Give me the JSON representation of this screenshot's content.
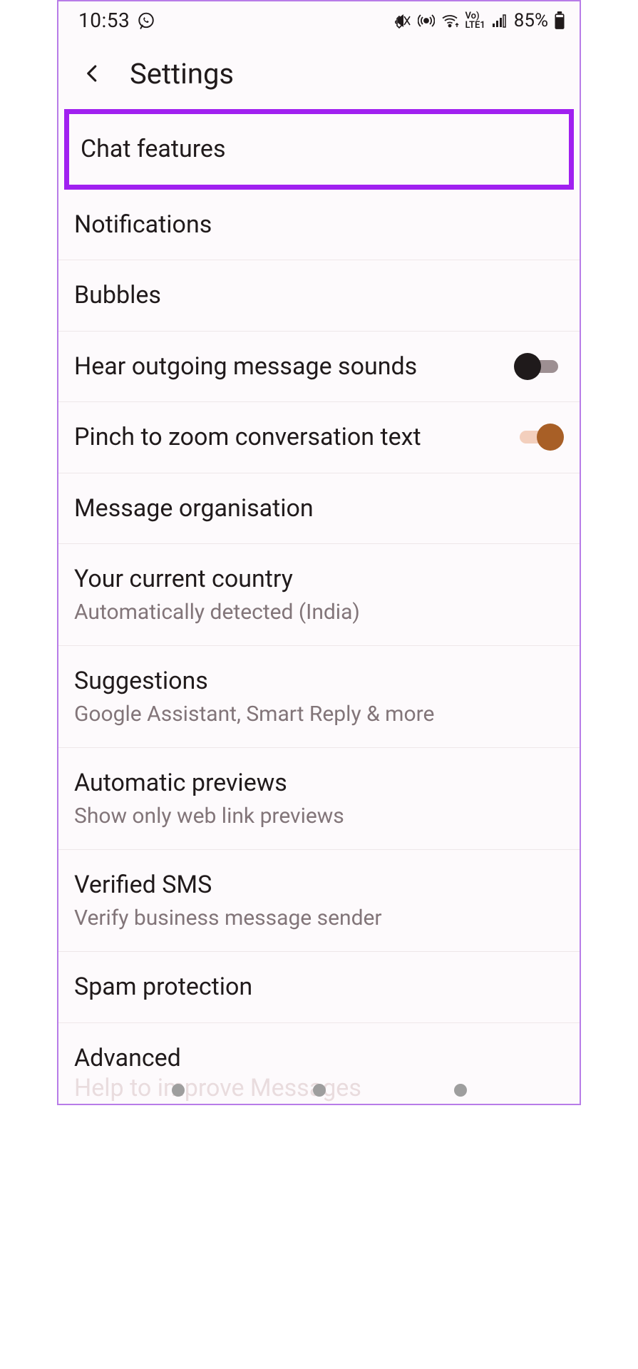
{
  "status": {
    "time": "10:53",
    "battery_pct": "85%",
    "lte_label": "Vo)\nLTE1"
  },
  "header": {
    "title": "Settings"
  },
  "rows": {
    "chat_features": "Chat features",
    "notifications": "Notifications",
    "bubbles": "Bubbles",
    "hear_sounds": "Hear outgoing message sounds",
    "pinch_zoom": "Pinch to zoom conversation text",
    "message_org": "Message organisation",
    "country_title": "Your current country",
    "country_sub": "Automatically detected (India)",
    "suggestions_title": "Suggestions",
    "suggestions_sub": "Google Assistant, Smart Reply & more",
    "previews_title": "Automatic previews",
    "previews_sub": "Show only web link previews",
    "verified_title": "Verified SMS",
    "verified_sub": "Verify business message sender",
    "spam": "Spam protection",
    "advanced": "Advanced",
    "help_improve": "Help to improve Messages"
  },
  "toggles": {
    "hear_sounds": false,
    "pinch_zoom": true
  }
}
